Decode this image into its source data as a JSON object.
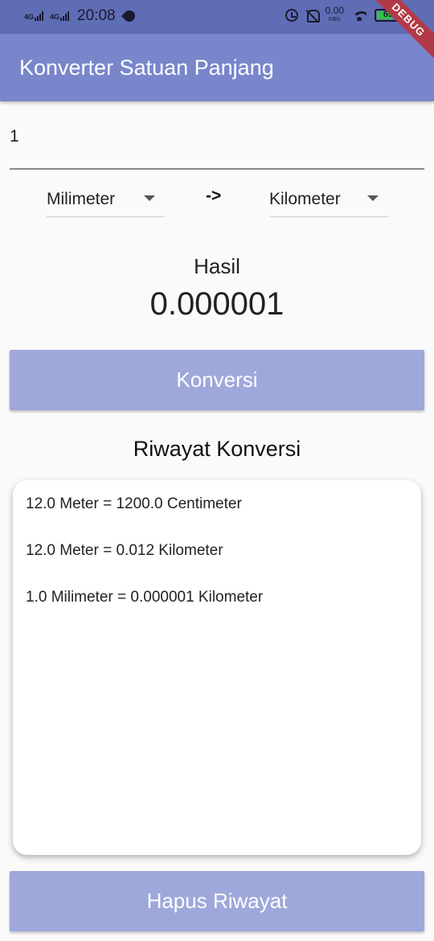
{
  "status_bar": {
    "network_1": "4G",
    "network_2": "4G",
    "time": "20:08",
    "speed_value": "0.00",
    "speed_unit": "KB/s",
    "battery_level": "69"
  },
  "debug_banner": "DEBUG",
  "app_bar": {
    "title": "Konverter Satuan Panjang",
    "color": "#7986cb"
  },
  "input": {
    "value": "1"
  },
  "from_unit": {
    "selected": "Milimeter"
  },
  "arrow_label": "->",
  "to_unit": {
    "selected": "Kilometer"
  },
  "result": {
    "label": "Hasil",
    "value": "0.000001"
  },
  "convert_button": {
    "label": "Konversi",
    "color": "#9fa8da"
  },
  "history": {
    "title": "Riwayat Konversi",
    "items": [
      "12.0 Meter = 1200.0 Centimeter",
      "12.0 Meter = 0.012 Kilometer",
      "1.0 Milimeter = 0.000001 Kilometer"
    ]
  },
  "clear_button": {
    "label": "Hapus Riwayat"
  }
}
